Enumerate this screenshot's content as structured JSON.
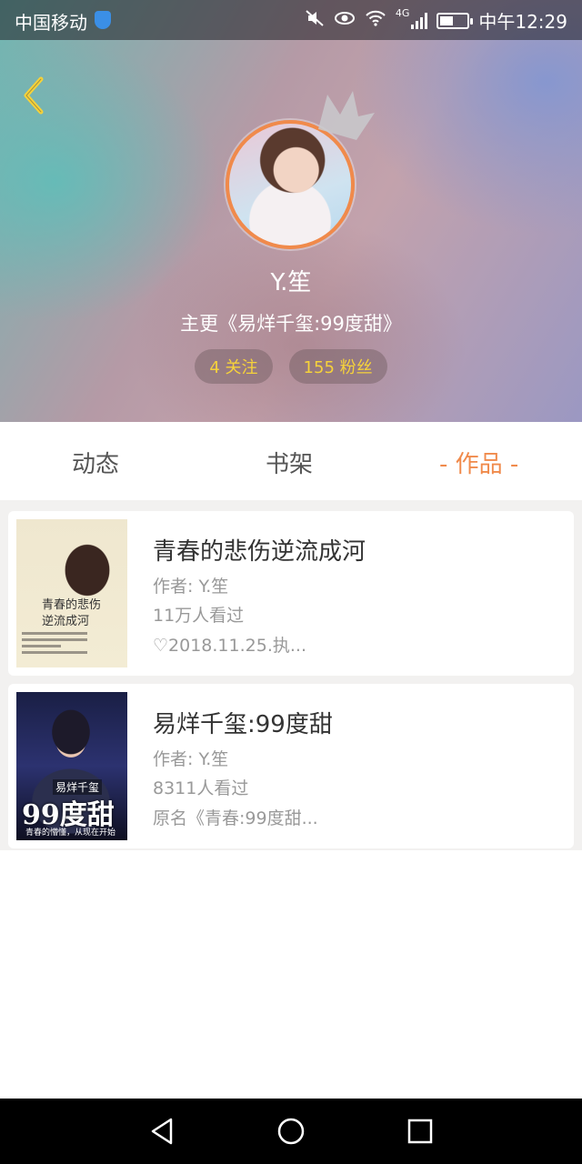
{
  "statusbar": {
    "carrier": "中国移动",
    "network": "4G",
    "time": "中午12:29"
  },
  "profile": {
    "name": "Y.笙",
    "main_work": "主更《易烊千玺:99度甜》",
    "following": "4 关注",
    "followers": "155 粉丝"
  },
  "tabs": [
    {
      "label": "动态",
      "active": false
    },
    {
      "label": "书架",
      "active": false
    },
    {
      "label": "- 作品 -",
      "active": true
    }
  ],
  "books": [
    {
      "title": "青春的悲伤逆流成河",
      "author": "作者: Y.笙",
      "views": "11万人看过",
      "note": "♡2018.11.25.执...",
      "cover_text": "青春的悲伤\n逆流成河"
    },
    {
      "title": "易烊千玺:99度甜",
      "author": "作者: Y.笙",
      "views": "8311人看过",
      "note": "原名《青春:99度甜...",
      "cover_small": "易烊千玺",
      "cover_big": "99度甜",
      "cover_foot": "青春的懵懂，从现在开始"
    }
  ],
  "colors": {
    "accent": "#f08a4b",
    "pill_text": "#f6d23a"
  },
  "icons": {
    "back": "chevron-left",
    "crown": "crown",
    "nav_back": "triangle-back",
    "nav_home": "circle-home",
    "nav_recent": "square-recent"
  }
}
